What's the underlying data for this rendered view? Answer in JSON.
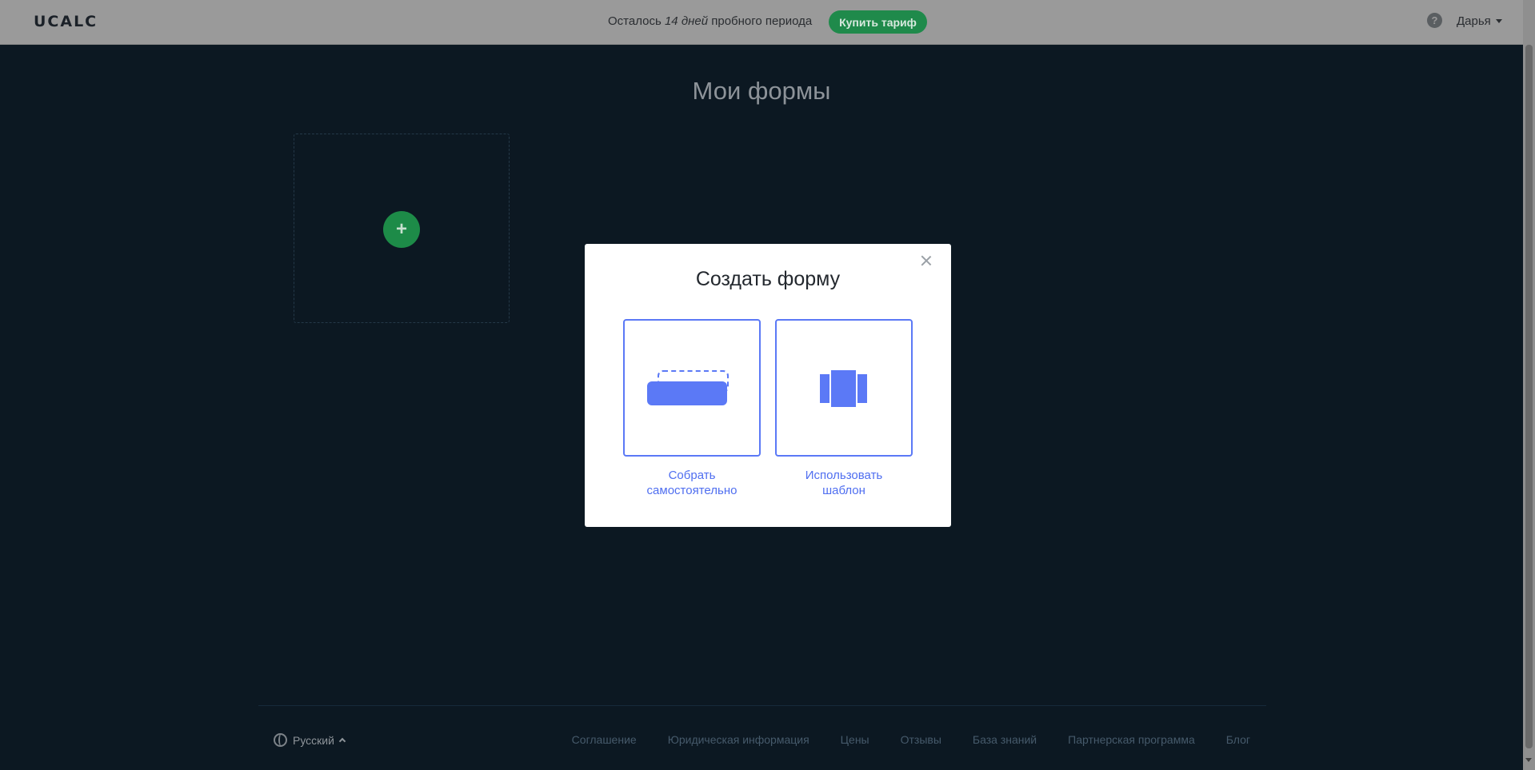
{
  "header": {
    "logo": "UCALC",
    "trial_prefix": "Осталось",
    "trial_days": "14 дней",
    "trial_suffix": "пробного периода",
    "buy_button": "Купить тариф",
    "help_icon": "?",
    "user_name": "Дарья"
  },
  "main": {
    "title": "Мои формы",
    "add_icon": "+"
  },
  "modal": {
    "title": "Создать форму",
    "options": [
      {
        "label_line1": "Собрать",
        "label_line2": "самостоятельно",
        "icon": "build-form-icon"
      },
      {
        "label_line1": "Использовать",
        "label_line2": "шаблон",
        "icon": "template-icon"
      }
    ]
  },
  "footer": {
    "language": "Русский",
    "links": [
      "Соглашение",
      "Юридическая информация",
      "Цены",
      "Отзывы",
      "База знаний",
      "Партнерская программа",
      "Блог"
    ]
  },
  "colors": {
    "accent": "#5b79f6",
    "green": "#1d8b48",
    "background": "#0c1822"
  }
}
